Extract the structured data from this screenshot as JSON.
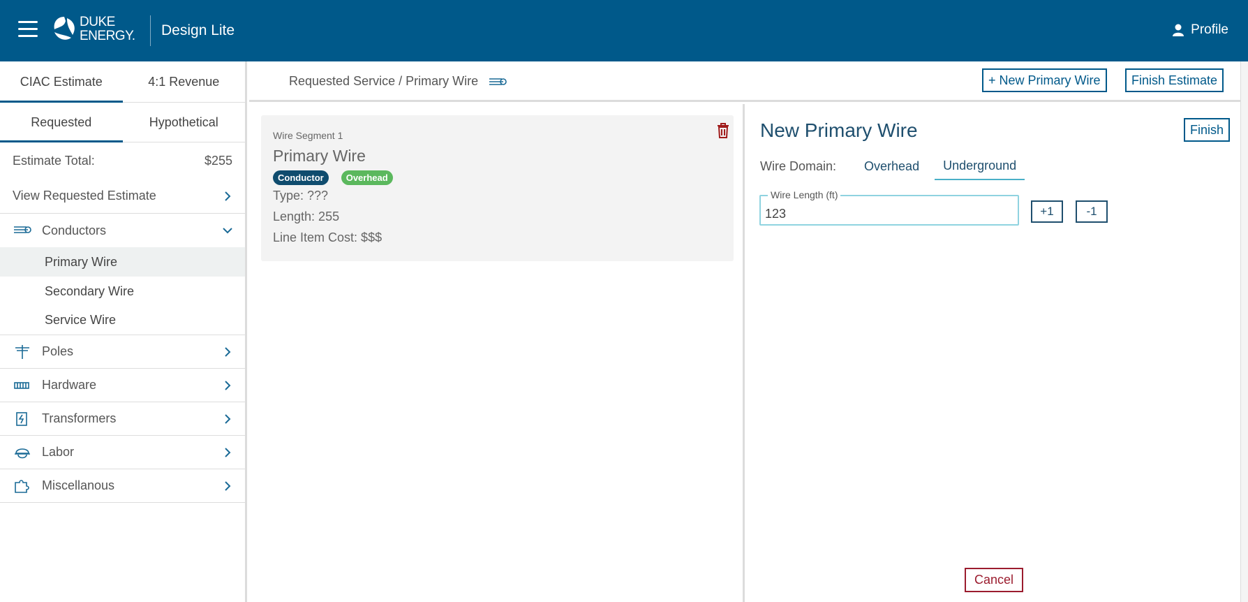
{
  "header": {
    "logo_line1": "DUKE",
    "logo_line2": "ENERGY.",
    "app_title": "Design Lite",
    "profile_label": "Profile",
    "brand_color": "#00598a"
  },
  "sidebar": {
    "tabs": [
      {
        "label": "CIAC Estimate",
        "active": true
      },
      {
        "label": "4:1 Revenue",
        "active": false
      }
    ],
    "subtabs": [
      {
        "label": "Requested",
        "active": true
      },
      {
        "label": "Hypothetical",
        "active": false
      }
    ],
    "estimate_total_label": "Estimate Total:",
    "estimate_total_value": "$255",
    "view_estimate_label": "View Requested Estimate",
    "categories": [
      {
        "label": "Conductors",
        "icon": "conductor-icon",
        "expanded": true
      },
      {
        "label": "Poles",
        "icon": "pole-icon"
      },
      {
        "label": "Hardware",
        "icon": "hardware-icon"
      },
      {
        "label": "Transformers",
        "icon": "transformer-icon"
      },
      {
        "label": "Labor",
        "icon": "hardhat-icon"
      },
      {
        "label": "Miscellanous",
        "icon": "puzzle-icon"
      }
    ],
    "conductor_items": [
      {
        "label": "Primary Wire",
        "active": true
      },
      {
        "label": "Secondary Wire",
        "active": false
      },
      {
        "label": "Service Wire",
        "active": false
      }
    ]
  },
  "toolbar": {
    "breadcrumb": "Requested Service / Primary Wire",
    "new_primary_wire_label": "+ New Primary Wire",
    "finish_estimate_label": "Finish Estimate"
  },
  "segment_card": {
    "segment_label": "Wire Segment 1",
    "title": "Primary Wire",
    "badges": [
      "Conductor",
      "Overhead"
    ],
    "type_line": "Type: ???",
    "length_line": "Length: 255",
    "cost_line": "Line Item Cost: $$$"
  },
  "form": {
    "heading": "New Primary Wire",
    "finish_label": "Finish",
    "domain_label": "Wire Domain:",
    "domain_options": [
      "Overhead",
      "Underground"
    ],
    "domain_selected": "Underground",
    "wire_length_label": "Wire Length (ft)",
    "wire_length_value": "123",
    "increment_label": "+1",
    "decrement_label": "-1",
    "cancel_label": "Cancel"
  }
}
